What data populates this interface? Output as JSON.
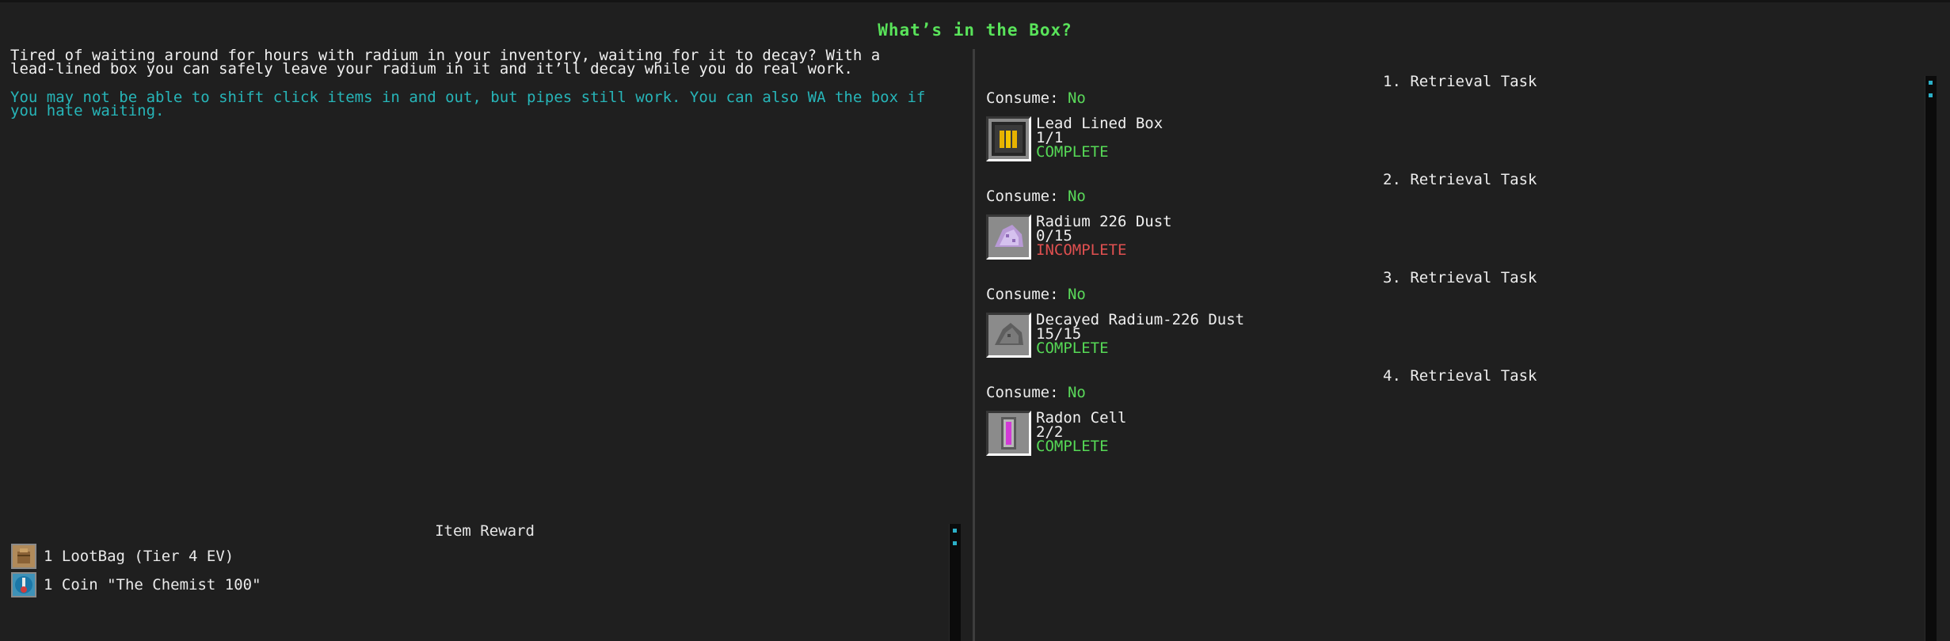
{
  "window": {
    "title": "What’s in the Box?"
  },
  "quest": {
    "description": "Tired of waiting around for hours with radium in your inventory, waiting for it to decay? With a lead-lined box you can safely leave your radium in it and it’ll decay while you do real work.",
    "note": "You may not be able to shift click items in and out, but pipes still work. You can also WA the box if you hate waiting."
  },
  "reward": {
    "title": "Item Reward",
    "items": [
      {
        "label": "1 LootBag (Tier 4 EV)",
        "icon": "lootbag-icon"
      },
      {
        "label": "1 Coin \"The Chemist 100\"",
        "icon": "coin-icon"
      }
    ]
  },
  "tasks": [
    {
      "heading": "1. Retrieval Task",
      "consume_label": "Consume:",
      "consume_value": "No",
      "item": "Lead Lined Box",
      "count": "1/1",
      "status": "COMPLETE",
      "icon": "lead-lined-box-icon"
    },
    {
      "heading": "2. Retrieval Task",
      "consume_label": "Consume:",
      "consume_value": "No",
      "item": "Radium 226 Dust",
      "count": "0/15",
      "status": "INCOMPLETE",
      "icon": "radium-dust-icon"
    },
    {
      "heading": "3. Retrieval Task",
      "consume_label": "Consume:",
      "consume_value": "No",
      "item": "Decayed Radium-226 Dust",
      "count": "15/15",
      "status": "COMPLETE",
      "icon": "decayed-dust-icon"
    },
    {
      "heading": "4. Retrieval Task",
      "consume_label": "Consume:",
      "consume_value": "No",
      "item": "Radon Cell",
      "count": "2/2",
      "status": "COMPLETE",
      "icon": "radon-cell-icon"
    }
  ],
  "colors": {
    "title": "#59e35a",
    "note": "#27b5b8",
    "complete": "#56d956",
    "incomplete": "#e05050",
    "background": "#1f1f1f"
  }
}
